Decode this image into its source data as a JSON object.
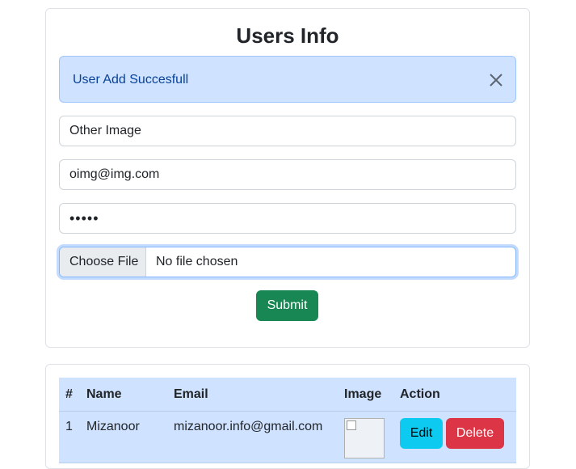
{
  "form": {
    "title": "Users Info",
    "alert": {
      "message": "User Add Succesfull",
      "close_icon": "close-icon"
    },
    "name_value": "Other Image",
    "email_value": "oimg@img.com",
    "password_masked": "•••••",
    "file_button_label": "Choose File",
    "file_status": "No file chosen",
    "submit_label": "Submit"
  },
  "table": {
    "headers": [
      "#",
      "Name",
      "Email",
      "Image",
      "Action"
    ],
    "rows": [
      {
        "index": "1",
        "name": "Mizanoor",
        "email": "mizanoor.info@gmail.com",
        "edit_label": "Edit",
        "delete_label": "Delete"
      }
    ]
  },
  "colors": {
    "alert_bg": "#cfe2ff",
    "submit": "#198754",
    "edit": "#0dcaf0",
    "delete": "#dc3545",
    "table_bg": "#cfe2ff"
  }
}
